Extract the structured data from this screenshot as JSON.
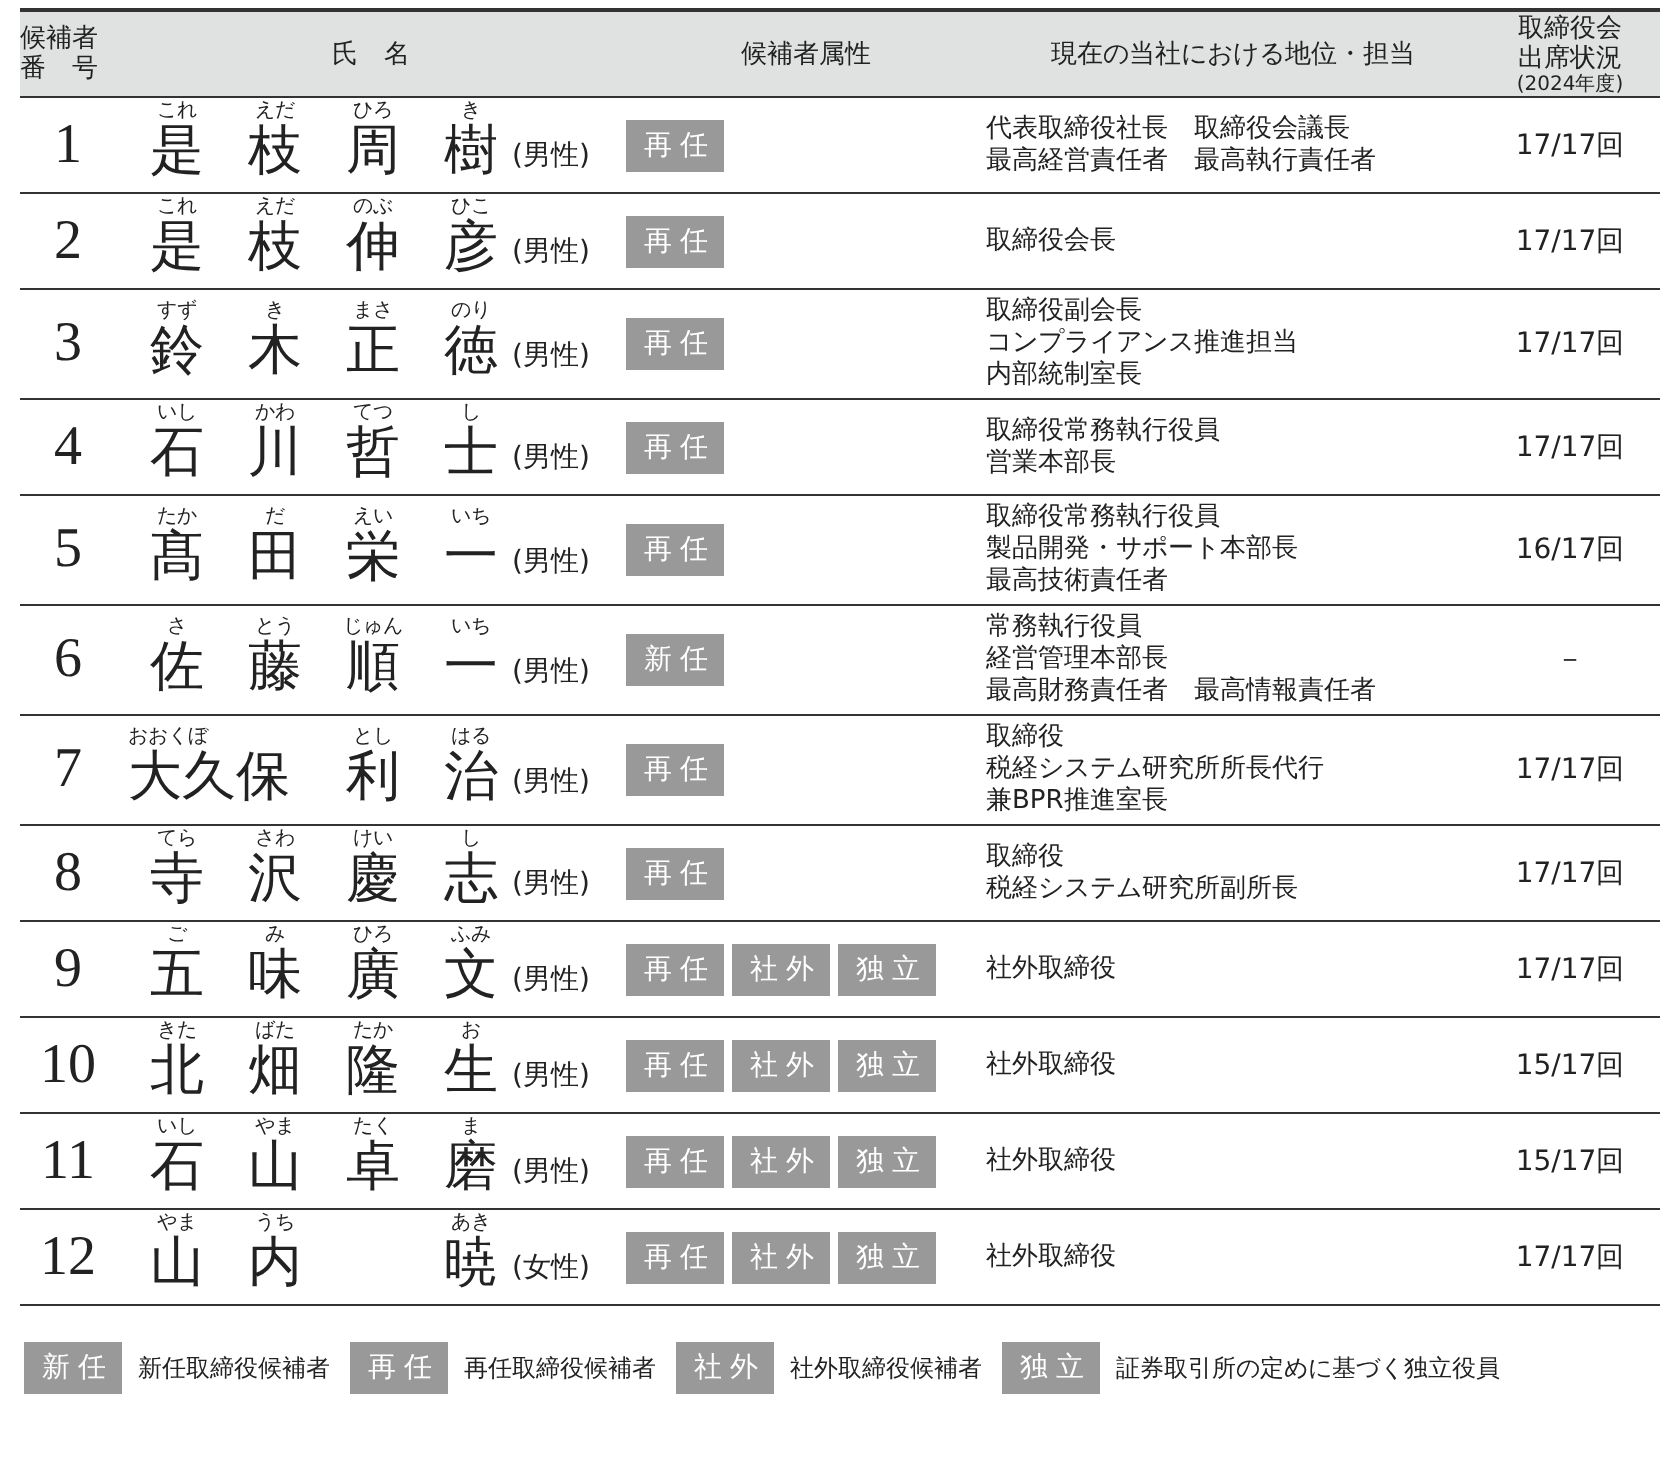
{
  "table": {
    "columns": [
      {
        "lines": [
          "候補者",
          "番　号"
        ]
      },
      {
        "lines": [
          "氏　名"
        ]
      },
      {
        "lines": [
          "候補者属性"
        ]
      },
      {
        "lines": [
          "現在の当社における地位・担当"
        ]
      },
      {
        "lines": [
          "取締役会",
          "出席状況"
        ],
        "note": "(2024年度)"
      }
    ],
    "rows": [
      {
        "number": "1",
        "name": [
          {
            "kanji": "是",
            "reading": "これ",
            "kind": "normal"
          },
          {
            "kanji": "枝",
            "reading": "えだ",
            "kind": "normal"
          },
          {
            "kanji": "周",
            "reading": "ひろ",
            "kind": "normal"
          },
          {
            "kanji": "樹",
            "reading": "き",
            "kind": "normal"
          }
        ],
        "gender": "(男性)",
        "tags": [
          "再任"
        ],
        "position": [
          "代表取締役社長　取締役会議長",
          "最高経営責任者　最高執行責任者"
        ],
        "attendance": "17/17回"
      },
      {
        "number": "2",
        "name": [
          {
            "kanji": "是",
            "reading": "これ",
            "kind": "normal"
          },
          {
            "kanji": "枝",
            "reading": "えだ",
            "kind": "normal"
          },
          {
            "kanji": "伸",
            "reading": "のぶ",
            "kind": "normal"
          },
          {
            "kanji": "彦",
            "reading": "ひこ",
            "kind": "normal"
          }
        ],
        "gender": "(男性)",
        "tags": [
          "再任"
        ],
        "position": [
          "取締役会長"
        ],
        "attendance": "17/17回"
      },
      {
        "number": "3",
        "name": [
          {
            "kanji": "鈴",
            "reading": "すず",
            "kind": "normal"
          },
          {
            "kanji": "木",
            "reading": "き",
            "kind": "normal"
          },
          {
            "kanji": "正",
            "reading": "まさ",
            "kind": "normal"
          },
          {
            "kanji": "徳",
            "reading": "のり",
            "kind": "normal"
          }
        ],
        "gender": "(男性)",
        "tags": [
          "再任"
        ],
        "position": [
          "取締役副会長",
          "コンプライアンス推進担当",
          "内部統制室長"
        ],
        "attendance": "17/17回"
      },
      {
        "number": "4",
        "name": [
          {
            "kanji": "石",
            "reading": "いし",
            "kind": "normal"
          },
          {
            "kanji": "川",
            "reading": "かわ",
            "kind": "normal"
          },
          {
            "kanji": "哲",
            "reading": "てつ",
            "kind": "normal"
          },
          {
            "kanji": "士",
            "reading": "し",
            "kind": "normal"
          }
        ],
        "gender": "(男性)",
        "tags": [
          "再任"
        ],
        "position": [
          "取締役常務執行役員",
          "営業本部長"
        ],
        "attendance": "17/17回"
      },
      {
        "number": "5",
        "name": [
          {
            "kanji": "髙",
            "reading": "たか",
            "kind": "normal"
          },
          {
            "kanji": "田",
            "reading": "だ",
            "kind": "normal"
          },
          {
            "kanji": "栄",
            "reading": "えい",
            "kind": "normal"
          },
          {
            "kanji": "一",
            "reading": "いち",
            "kind": "normal"
          }
        ],
        "gender": "(男性)",
        "tags": [
          "再任"
        ],
        "position": [
          "取締役常務執行役員",
          "製品開発・サポート本部長",
          "最高技術責任者"
        ],
        "attendance": "16/17回"
      },
      {
        "number": "6",
        "name": [
          {
            "kanji": "佐",
            "reading": "さ",
            "kind": "normal"
          },
          {
            "kanji": "藤",
            "reading": "とう",
            "kind": "normal"
          },
          {
            "kanji": "順",
            "reading": "じゅん",
            "kind": "normal"
          },
          {
            "kanji": "一",
            "reading": "いち",
            "kind": "normal"
          }
        ],
        "gender": "(男性)",
        "tags": [
          "新任"
        ],
        "position": [
          "常務執行役員",
          "経営管理本部長",
          "最高財務責任者　最高情報責任者"
        ],
        "attendance": "－"
      },
      {
        "number": "7",
        "name": [
          {
            "kanji": "大久保",
            "reading": "おおくぼ",
            "kind": "wide"
          },
          {
            "kanji": "利",
            "reading": "とし",
            "kind": "normal"
          },
          {
            "kanji": "治",
            "reading": "はる",
            "kind": "normal"
          }
        ],
        "gender": "(男性)",
        "tags": [
          "再任"
        ],
        "position": [
          "取締役",
          "税経システム研究所所長代行",
          "兼BPR推進室長"
        ],
        "attendance": "17/17回"
      },
      {
        "number": "8",
        "name": [
          {
            "kanji": "寺",
            "reading": "てら",
            "kind": "normal"
          },
          {
            "kanji": "沢",
            "reading": "さわ",
            "kind": "normal"
          },
          {
            "kanji": "慶",
            "reading": "けい",
            "kind": "normal"
          },
          {
            "kanji": "志",
            "reading": "し",
            "kind": "normal"
          }
        ],
        "gender": "(男性)",
        "tags": [
          "再任"
        ],
        "position": [
          "取締役",
          "税経システム研究所副所長"
        ],
        "attendance": "17/17回"
      },
      {
        "number": "9",
        "name": [
          {
            "kanji": "五",
            "reading": "ご",
            "kind": "normal"
          },
          {
            "kanji": "味",
            "reading": "み",
            "kind": "normal"
          },
          {
            "kanji": "廣",
            "reading": "ひろ",
            "kind": "normal"
          },
          {
            "kanji": "文",
            "reading": "ふみ",
            "kind": "normal"
          }
        ],
        "gender": "(男性)",
        "tags": [
          "再任",
          "社外",
          "独立"
        ],
        "position": [
          "社外取締役"
        ],
        "attendance": "17/17回"
      },
      {
        "number": "10",
        "name": [
          {
            "kanji": "北",
            "reading": "きた",
            "kind": "normal"
          },
          {
            "kanji": "畑",
            "reading": "ばた",
            "kind": "normal"
          },
          {
            "kanji": "隆",
            "reading": "たか",
            "kind": "normal"
          },
          {
            "kanji": "生",
            "reading": "お",
            "kind": "normal"
          }
        ],
        "gender": "(男性)",
        "tags": [
          "再任",
          "社外",
          "独立"
        ],
        "position": [
          "社外取締役"
        ],
        "attendance": "15/17回"
      },
      {
        "number": "11",
        "name": [
          {
            "kanji": "石",
            "reading": "いし",
            "kind": "normal"
          },
          {
            "kanji": "山",
            "reading": "やま",
            "kind": "normal"
          },
          {
            "kanji": "卓",
            "reading": "たく",
            "kind": "normal"
          },
          {
            "kanji": "磨",
            "reading": "ま",
            "kind": "normal"
          }
        ],
        "gender": "(男性)",
        "tags": [
          "再任",
          "社外",
          "独立"
        ],
        "position": [
          "社外取締役"
        ],
        "attendance": "15/17回"
      },
      {
        "number": "12",
        "name": [
          {
            "kanji": "山",
            "reading": "やま",
            "kind": "normal"
          },
          {
            "kanji": "内",
            "reading": "うち",
            "kind": "normal"
          },
          {
            "kanji": "暁",
            "reading": "あき",
            "kind": "end"
          }
        ],
        "gender": "(女性)",
        "tags": [
          "再任",
          "社外",
          "独立"
        ],
        "position": [
          "社外取締役"
        ],
        "attendance": "17/17回"
      }
    ]
  },
  "legend": [
    {
      "tag": "新任",
      "text": "新任取締役候補者"
    },
    {
      "tag": "再任",
      "text": "再任取締役候補者"
    },
    {
      "tag": "社外",
      "text": "社外取締役候補者"
    },
    {
      "tag": "独立",
      "text": "証券取引所の定めに基づく独立役員"
    }
  ]
}
